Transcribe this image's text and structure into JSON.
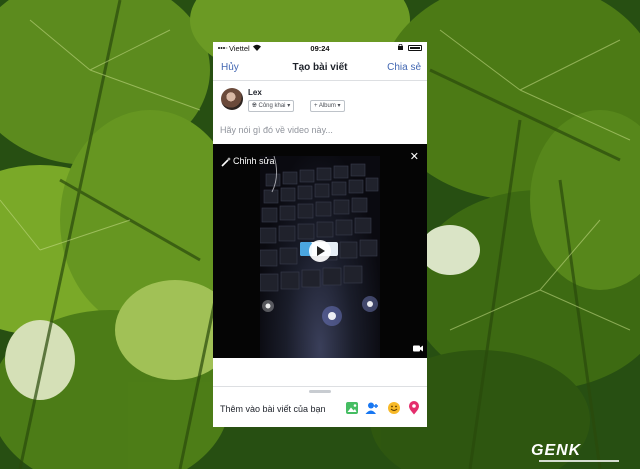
{
  "status_bar": {
    "carrier": "Viettel",
    "time": "09:24"
  },
  "nav": {
    "cancel_label": "Hủy",
    "title": "Tạo bài viết",
    "share_label": "Chia sẻ"
  },
  "post": {
    "username": "Lex",
    "audience_label": "Công khai",
    "album_label": "+ Album",
    "placeholder": "Hãy nói gì đó về video này..."
  },
  "video": {
    "edit_label": "Chỉnh sửa",
    "close_glyph": "✕"
  },
  "add_to_post": {
    "label": "Thêm vào bài viết của bạn",
    "icons": [
      "photo-icon",
      "tag-people-icon",
      "feeling-icon",
      "location-icon"
    ]
  },
  "watermark": {
    "text": "GENK"
  },
  "colors": {
    "link_blue": "#4267b2",
    "photo_green": "#45bd62",
    "tag_blue": "#1877f2",
    "feeling_yellow": "#f7b928",
    "location_pink": "#e42d6c"
  }
}
